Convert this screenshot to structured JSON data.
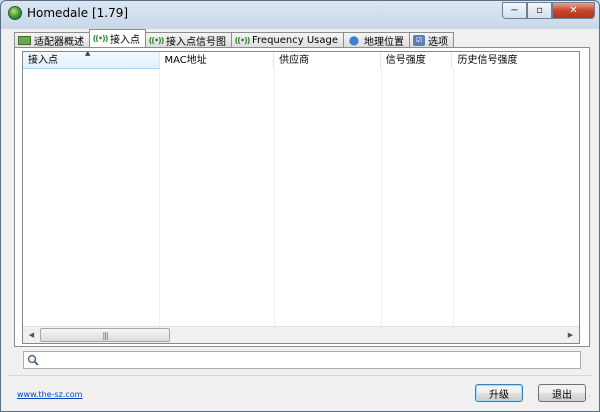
{
  "window": {
    "title": "Homedale [1.79]",
    "minimize": "−",
    "maximize": "▫",
    "close": "✕"
  },
  "tabs": [
    {
      "label": "适配器概述",
      "icon": "network-adapter-icon",
      "active": false
    },
    {
      "label": "接入点",
      "icon": "wifi-signal-icon",
      "active": true
    },
    {
      "label": "接入点信号图",
      "icon": "wifi-signal-icon",
      "active": false
    },
    {
      "label": "Frequency Usage",
      "icon": "wifi-signal-icon",
      "active": false
    },
    {
      "label": "地理位置",
      "icon": "location-pin-icon",
      "active": false
    },
    {
      "label": "选项",
      "icon": "options-icon",
      "active": false
    }
  ],
  "table": {
    "columns": [
      "接入点",
      "MAC地址",
      "供应商",
      "信号强度",
      "历史信号强度"
    ],
    "sorted_column": "接入点",
    "rows": []
  },
  "search": {
    "value": "",
    "placeholder": ""
  },
  "footer": {
    "link": "www.the-sz.com",
    "upgrade_button": "升级",
    "exit_button": "退出"
  }
}
